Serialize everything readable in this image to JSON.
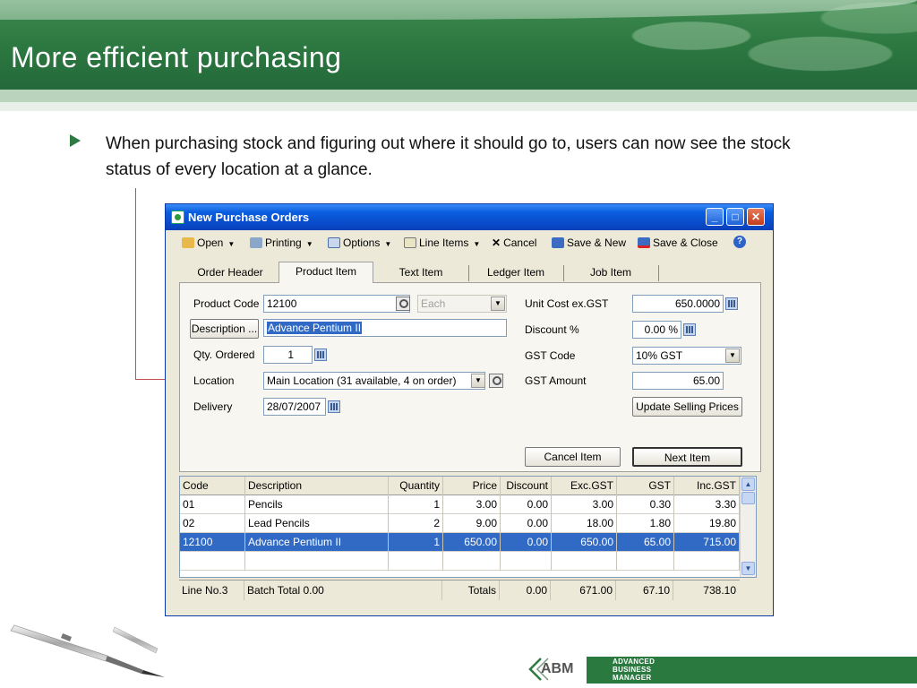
{
  "slide": {
    "title": "More efficient purchasing",
    "bullet": "When purchasing stock and figuring out where it should go to, users can now see the stock status of every location at a glance."
  },
  "window": {
    "title": "New Purchase Orders",
    "controls": {
      "minimize": "_",
      "maximize": "□",
      "close": "✕"
    }
  },
  "toolbar": {
    "open": "Open",
    "printing": "Printing",
    "options": "Options",
    "line_items": "Line Items",
    "cancel": "Cancel",
    "save_new": "Save & New",
    "save_close": "Save & Close",
    "help": "?"
  },
  "tabs": [
    "Order Header",
    "Product Item",
    "Text Item",
    "Ledger Item",
    "Job Item"
  ],
  "form": {
    "product_code_label": "Product Code",
    "product_code": "12100",
    "unit_placeholder": "Each",
    "description_button": "Description ...",
    "description": "Advance Pentium II",
    "qty_label": "Qty. Ordered",
    "qty": "1",
    "location_label": "Location",
    "location": "Main Location (31 available, 4 on order)",
    "delivery_label": "Delivery",
    "delivery": "28/07/2007",
    "unit_cost_label": "Unit Cost ex.GST",
    "unit_cost": "650.0000",
    "discount_label": "Discount %",
    "discount": "0.00 %",
    "gst_code_label": "GST Code",
    "gst_code": "10% GST",
    "gst_amount_label": "GST Amount",
    "gst_amount": "65.00",
    "update_prices": "Update Selling Prices",
    "cancel_item": "Cancel Item",
    "next_item": "Next Item"
  },
  "grid": {
    "columns": [
      "Code",
      "Description",
      "Quantity",
      "Price",
      "Discount",
      "Exc.GST",
      "GST",
      "Inc.GST"
    ],
    "rows": [
      [
        "01",
        "Pencils",
        "1",
        "3.00",
        "0.00",
        "3.00",
        "0.30",
        "3.30"
      ],
      [
        "02",
        "Lead Pencils",
        "2",
        "9.00",
        "0.00",
        "18.00",
        "1.80",
        "19.80"
      ],
      [
        "12100",
        "Advance Pentium II",
        "1",
        "650.00",
        "0.00",
        "650.00",
        "65.00",
        "715.00"
      ]
    ],
    "selected_row": 2,
    "totals": {
      "line_no": "Line No.3",
      "batch_total": "Batch Total 0.00",
      "label": "Totals",
      "discount": "0.00",
      "exc_gst": "671.00",
      "gst": "67.10",
      "inc_gst": "738.10"
    }
  },
  "brand": {
    "abm": "ABM",
    "line1": "ADVANCED",
    "line2": "BUSINESS",
    "line3": "MANAGER",
    "green": "#2e7a42"
  }
}
